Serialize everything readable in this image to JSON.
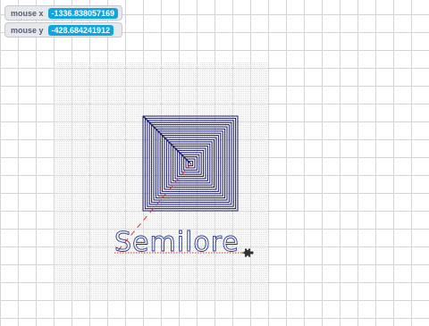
{
  "monitors": [
    {
      "label": "mouse x",
      "value": "-1336.838057169"
    },
    {
      "label": "mouse y",
      "value": "-428.684241912"
    }
  ],
  "canvas": {
    "text": "Semilore",
    "spiral_color": "#1a1a6e",
    "text_color": "#2b3a8c",
    "guide_color": "#e03030",
    "grid_color": "#d4d4d4",
    "dot_region_color": "#ececec",
    "turtle_icon": "turtle-icon"
  }
}
